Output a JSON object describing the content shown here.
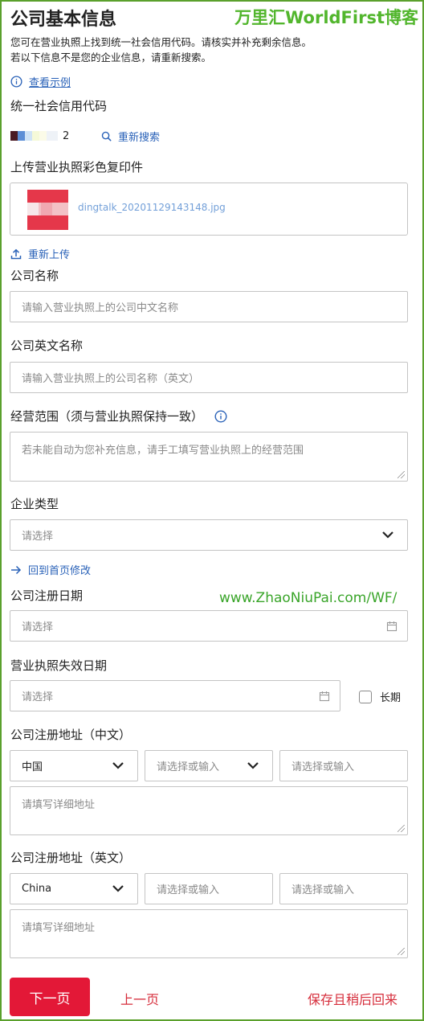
{
  "header": {
    "title": "公司基本信息",
    "watermark": "万里汇WorldFirst博客"
  },
  "intro": {
    "line1": "您可在营业执照上找到统一社会信用代码。请核实并补充剩余信息。",
    "line2": "若以下信息不是您的企业信息，请重新搜索。"
  },
  "example_link": "查看示例",
  "credit_code": {
    "label": "统一社会信用代码",
    "value_suffix": "2",
    "research_label": "重新搜索"
  },
  "upload": {
    "label": "上传营业执照彩色复印件",
    "filename": "dingtalk_20201129143148.jpg",
    "reupload_label": "重新上传"
  },
  "company_name": {
    "label": "公司名称",
    "placeholder": "请输入营业执照上的公司中文名称"
  },
  "company_name_en": {
    "label": "公司英文名称",
    "placeholder": "请输入营业执照上的公司名称（英文）"
  },
  "business_scope": {
    "label": "经营范围（须与营业执照保持一致）",
    "placeholder": "若未能自动为您补充信息，请手工填写营业执照上的经营范围"
  },
  "company_type": {
    "label": "企业类型",
    "placeholder": "请选择",
    "back_link": "回到首页修改"
  },
  "registration_date": {
    "label": "公司注册日期",
    "placeholder": "请选择"
  },
  "watermark_url": "www.ZhaoNiuPai.com/WF/",
  "license_expiry": {
    "label": "营业执照失效日期",
    "placeholder": "请选择",
    "long_term_label": "长期"
  },
  "address_cn": {
    "label": "公司注册地址（中文）",
    "country": "中国",
    "province_placeholder": "请选择或输入",
    "city_placeholder": "请选择或输入",
    "detail_placeholder": "请填写详细地址"
  },
  "address_en": {
    "label": "公司注册地址（英文）",
    "country": "China",
    "province_placeholder": "请选择或输入",
    "city_placeholder": "请选择或输入",
    "detail_placeholder": "请填写详细地址"
  },
  "footer": {
    "next_label": "下一页",
    "prev_label": "上一页",
    "save_label": "保存且稍后回来"
  },
  "colors": {
    "brand_red": "#e31837",
    "link_blue": "#2a62b8",
    "watermark_green": "#52b62d"
  }
}
